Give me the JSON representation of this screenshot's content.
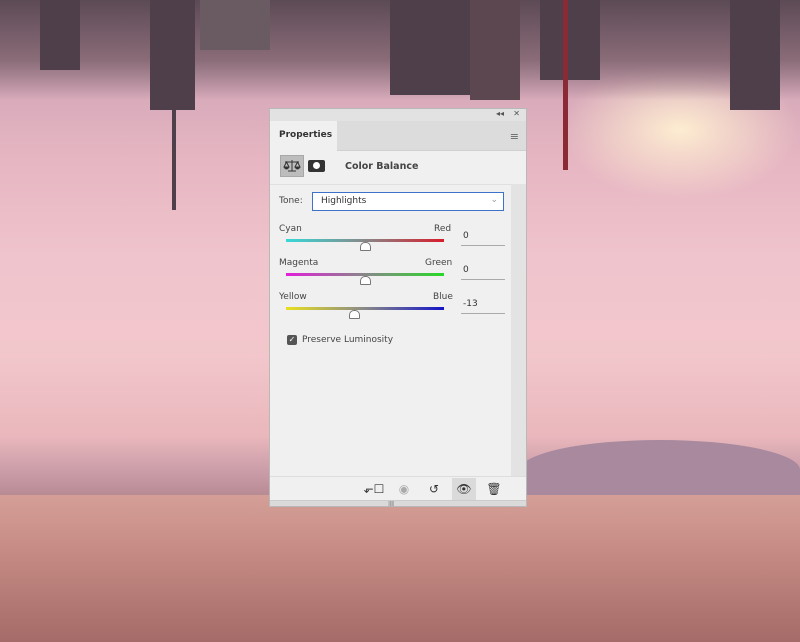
{
  "panel": {
    "tab": "Properties",
    "title": "Color Balance",
    "collapse_icon": "double-chevron-left",
    "close_icon": "close"
  },
  "tone": {
    "label": "Tone:",
    "value": "Highlights"
  },
  "sliders": [
    {
      "left": "Cyan",
      "right": "Red",
      "value": "0",
      "num": 0,
      "from": "#36d8d8",
      "to": "#d81c2c"
    },
    {
      "left": "Magenta",
      "right": "Green",
      "value": "0",
      "num": 0,
      "from": "#e020d8",
      "to": "#28d828"
    },
    {
      "left": "Yellow",
      "right": "Blue",
      "value": "-13",
      "num": -13,
      "from": "#e8e020",
      "to": "#1414c8"
    }
  ],
  "preserve_luminosity": {
    "label": "Preserve Luminosity",
    "checked": true
  }
}
